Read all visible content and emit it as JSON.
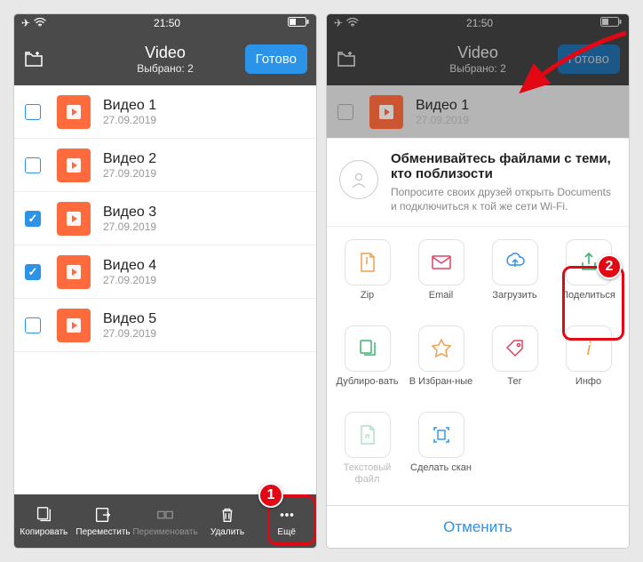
{
  "statusbar": {
    "time": "21:50"
  },
  "nav": {
    "title": "Video",
    "subtitle": "Выбрано: 2",
    "done": "Готово"
  },
  "files": [
    {
      "title": "Видео 1",
      "date": "27.09.2019",
      "checked": false
    },
    {
      "title": "Видео 2",
      "date": "27.09.2019",
      "checked": false
    },
    {
      "title": "Видео 3",
      "date": "27.09.2019",
      "checked": true
    },
    {
      "title": "Видео 4",
      "date": "27.09.2019",
      "checked": true
    },
    {
      "title": "Видео 5",
      "date": "27.09.2019",
      "checked": false
    }
  ],
  "toolbar": {
    "copy": "Копировать",
    "move": "Переместить",
    "rename": "Переименовать",
    "delete": "Удалить",
    "more": "Ещё"
  },
  "sheet": {
    "nearby_title": "Обменивайтесь файлами с теми, кто поблизости",
    "nearby_body": "Попросите своих друзей открыть Documents и подключиться к той же сети Wi-Fi.",
    "actions": {
      "zip": "Zip",
      "email": "Email",
      "upload": "Загрузить",
      "share": "Поделиться",
      "duplicate": "Дублиро-вать",
      "favorite": "В Избран-ные",
      "tag": "Тег",
      "info": "Инфо",
      "textfile": "Текстовый файл",
      "scan": "Сделать скан"
    },
    "cancel": "Отменить"
  },
  "colors": {
    "accent": "#2b93e8",
    "thumb": "#ff6b3d",
    "callout": "#e30613"
  },
  "annotations": {
    "badge1": "1",
    "badge2": "2"
  }
}
